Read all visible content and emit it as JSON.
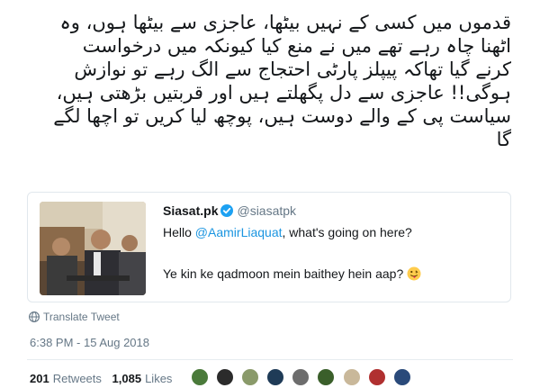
{
  "tweet": {
    "lines": [
      "قدموں میں کسی کے نہیں بیٹھا، عاجزی سے بیٹھا ہوں، وہ",
      "اٹھنا چاہ رہے تھے میں نے منع کیا کیونکہ میں درخواست",
      "کرنے گیا تھاکہ پیپلز پارٹی احتجاج سے الگ رہے تو نوازش",
      "ہوگی!! عاجزی سے دل پگھلتے ہیں اور قربتیں بڑھتی ہیں،",
      "سیاست پی کے والے دوست ہیں، پوچھ لیا کریں تو اچھا لگے",
      "گا"
    ]
  },
  "quote": {
    "name": "Siasat.pk",
    "handle": "@siasatpk",
    "line1_prefix": "Hello ",
    "line1_mention": "@AamirLiaquat",
    "line1_suffix": ", what's going on here?",
    "line2": "Ye kin ke qadmoon mein baithey hein aap?",
    "verified_color": "#1da1f2"
  },
  "translate_label": "Translate Tweet",
  "timestamp": "6:38 PM - 15 Aug 2018",
  "stats": {
    "retweets_count": "201",
    "retweets_label": "Retweets",
    "likes_count": "1,085",
    "likes_label": "Likes"
  },
  "colors": {
    "text": "#14171a",
    "secondary": "#657786",
    "link": "#1b95e0",
    "border": "#e1e8ed"
  },
  "avatars": [
    {
      "color": "#4a7a3a"
    },
    {
      "color": "#2b2b2b"
    },
    {
      "color": "#8a9a6a"
    },
    {
      "color": "#1f3b57"
    },
    {
      "color": "#6d6d6d"
    },
    {
      "color": "#3a5f2a"
    },
    {
      "color": "#c9b89a"
    },
    {
      "color": "#b03030"
    },
    {
      "color": "#2a4a7a"
    }
  ]
}
